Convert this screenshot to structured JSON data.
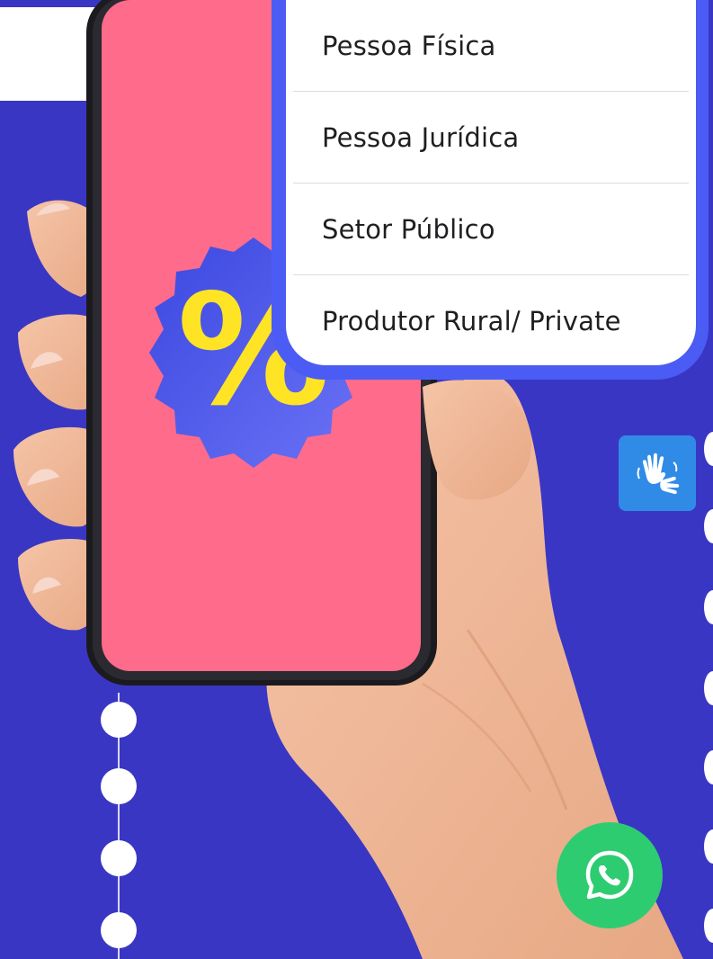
{
  "menu": {
    "items": [
      {
        "label": "Pessoa Física"
      },
      {
        "label": "Pessoa Jurídica"
      },
      {
        "label": "Setor Público"
      },
      {
        "label": "Produtor Rural/ Private"
      }
    ]
  },
  "icons": {
    "accessibility": "sign-language-hands-icon",
    "whatsapp": "whatsapp-icon",
    "badge": "percent-badge-icon"
  },
  "colors": {
    "background": "#3a36c4",
    "menu_border": "#4b5cf5",
    "phone_screen": "#ff6b8a",
    "badge": "#4f5cf0",
    "percent_sign": "#ffe426",
    "whatsapp": "#2ecc71",
    "accessibility_button": "#2f8be6"
  },
  "badge": {
    "symbol": "%"
  }
}
